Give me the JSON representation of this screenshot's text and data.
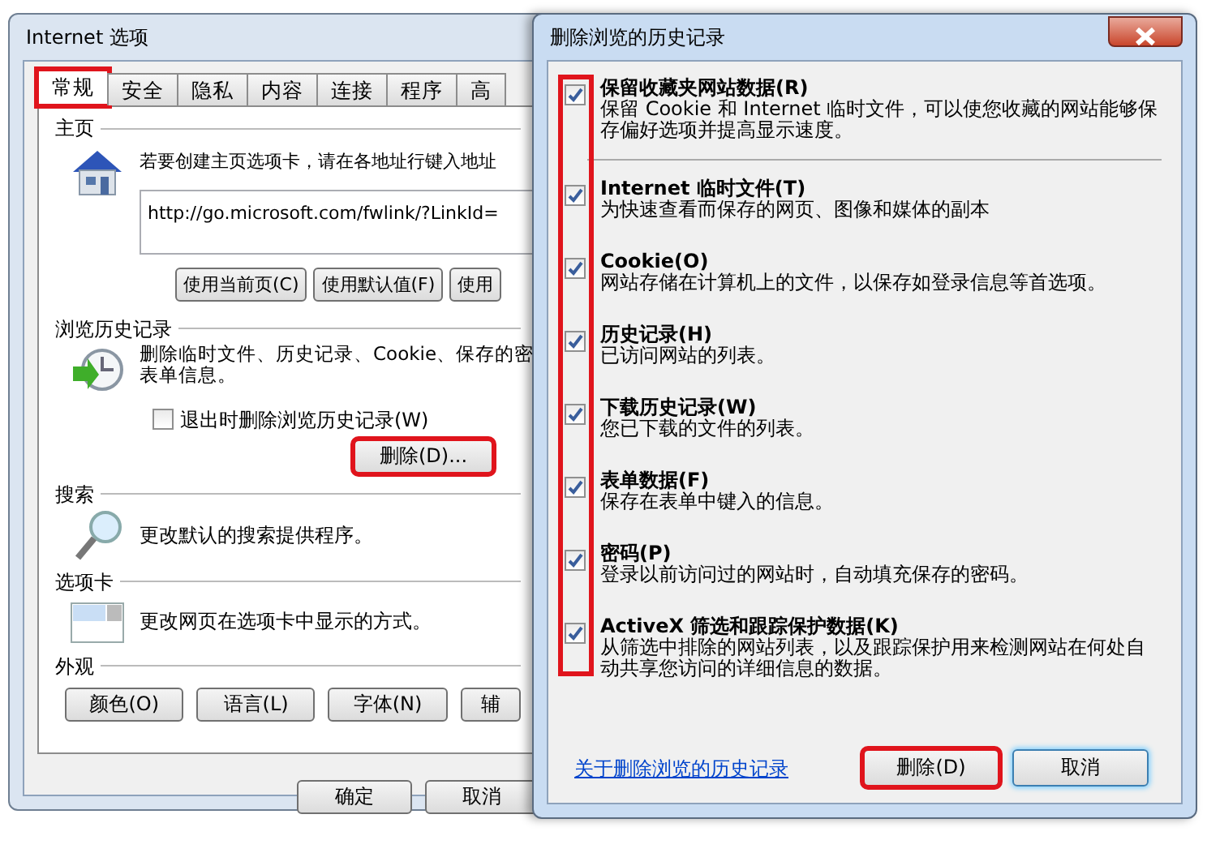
{
  "options_window": {
    "title": "Internet 选项",
    "tabs": [
      {
        "label": "常规",
        "selected": true,
        "annotated": true
      },
      {
        "label": "安全",
        "selected": false,
        "annotated": false
      },
      {
        "label": "隐私",
        "selected": false,
        "annotated": false
      },
      {
        "label": "内容",
        "selected": false,
        "annotated": false
      },
      {
        "label": "连接",
        "selected": false,
        "annotated": false
      },
      {
        "label": "程序",
        "selected": false,
        "annotated": false
      },
      {
        "label": "高",
        "selected": false,
        "annotated": false
      }
    ],
    "home_page": {
      "heading": "主页",
      "description": "若要创建主页选项卡，请在各地址行键入地址",
      "url": "http://go.microsoft.com/fwlink/?LinkId=",
      "buttons": [
        "使用当前页(C)",
        "使用默认值(F)",
        "使用"
      ]
    },
    "browsing_history": {
      "heading": "浏览历史记录",
      "description_lines": [
        "删除临时文件、历史记录、Cookie、保存的密",
        "表单信息。"
      ],
      "exit_checkbox": {
        "label": "退出时删除浏览历史记录(W)",
        "checked": false
      },
      "delete_button": {
        "label": "删除(D)...",
        "annotated": true
      }
    },
    "search": {
      "heading": "搜索",
      "description": "更改默认的搜索提供程序。"
    },
    "tabs_section": {
      "heading": "选项卡",
      "description": "更改网页在选项卡中显示的方式。"
    },
    "appearance": {
      "heading": "外观",
      "buttons": [
        "颜色(O)",
        "语言(L)",
        "字体(N)",
        "辅"
      ]
    },
    "footer_buttons": [
      "确定",
      "取消"
    ]
  },
  "delete_window": {
    "title": "删除浏览的历史记录",
    "checkbox_column_annotated": true,
    "items": [
      {
        "title": "保留收藏夹网站数据(R)",
        "description": "保留 Cookie 和 Internet 临时文件，可以使您收藏的网站能够保存偏好选项并提高显示速度。",
        "checked": true
      },
      {
        "title": "Internet 临时文件(T)",
        "description": "为快速查看而保存的网页、图像和媒体的副本",
        "checked": true
      },
      {
        "title": "Cookie(O)",
        "description": "网站存储在计算机上的文件，以保存如登录信息等首选项。",
        "checked": true
      },
      {
        "title": "历史记录(H)",
        "description": "已访问网站的列表。",
        "checked": true
      },
      {
        "title": "下载历史记录(W)",
        "description": "您已下载的文件的列表。",
        "checked": true
      },
      {
        "title": "表单数据(F)",
        "description": "保存在表单中键入的信息。",
        "checked": true
      },
      {
        "title": "密码(P)",
        "description": "登录以前访问过的网站时，自动填充保存的密码。",
        "checked": true
      },
      {
        "title": "ActiveX 筛选和跟踪保护数据(K)",
        "description": "从筛选中排除的网站列表，以及跟踪保护用来检测网站在何处自动共享您访问的详细信息的数据。",
        "checked": true
      }
    ],
    "link": "关于删除浏览的历史记录",
    "buttons": [
      {
        "label": "删除(D)",
        "annotated": true,
        "focused": false
      },
      {
        "label": "取消",
        "annotated": false,
        "focused": true
      }
    ]
  }
}
